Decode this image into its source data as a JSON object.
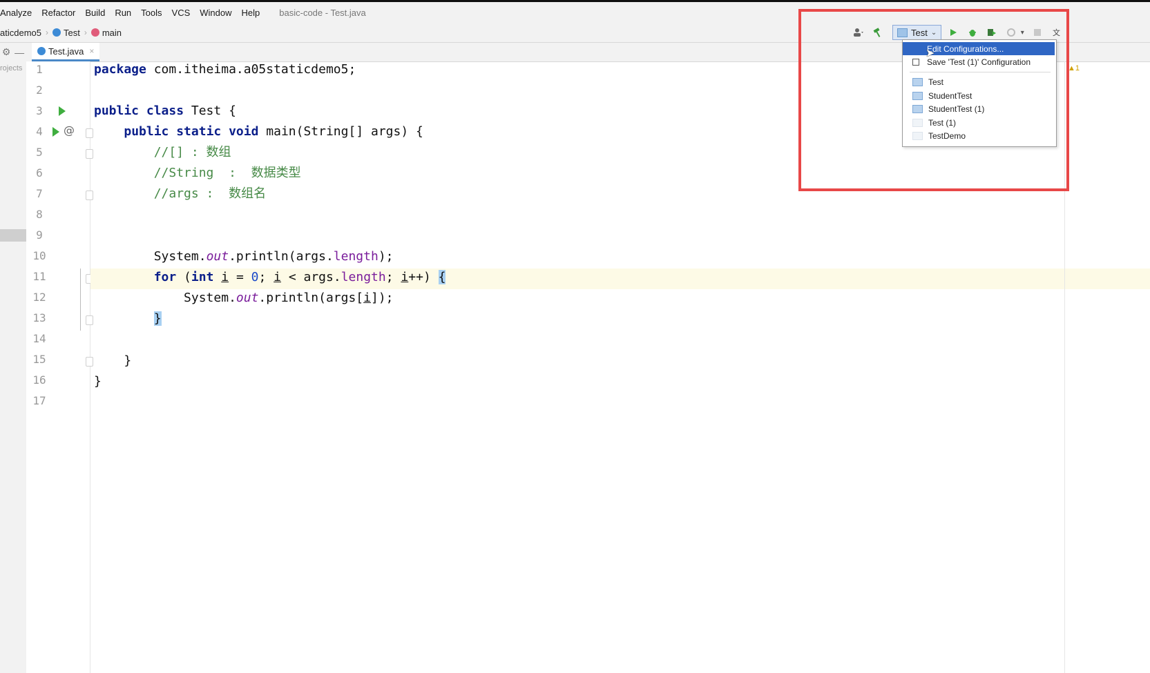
{
  "menu": {
    "items": [
      "Analyze",
      "Refactor",
      "Build",
      "Run",
      "Tools",
      "VCS",
      "Window",
      "Help"
    ],
    "window_title": "basic-code - Test.java"
  },
  "breadcrumb": {
    "package": "aticdemo5",
    "class": "Test",
    "method": "main"
  },
  "toolbar": {
    "run_config": "Test"
  },
  "tabs": [
    {
      "label": "Test.java",
      "active": true
    }
  ],
  "sidebar": {
    "project_label": "rojects"
  },
  "editor": {
    "line_numbers": [
      "1",
      "2",
      "3",
      "4",
      "5",
      "6",
      "7",
      "8",
      "9",
      "10",
      "11",
      "12",
      "13",
      "14",
      "15",
      "16",
      "17"
    ],
    "current_line": "11"
  },
  "run_config_menu": {
    "edit_configurations": "Edit Configurations...",
    "save_configuration": "Save 'Test (1)' Configuration",
    "configs": [
      "Test",
      "StudentTest",
      "StudentTest (1)",
      "Test (1)",
      "TestDemo"
    ]
  },
  "colors": {
    "keyword": "#0b1f8a",
    "comment": "#478a47",
    "number": "#1a49c9",
    "field": "#7a1d9b",
    "highlight_box": "#e84848",
    "selected_item": "#2f66c4"
  },
  "inspections": {
    "warning_count": "1"
  }
}
